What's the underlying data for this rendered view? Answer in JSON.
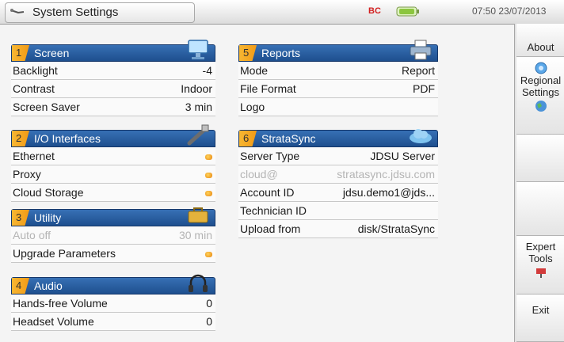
{
  "topbar": {
    "title": "System Settings",
    "bc_label": "BC",
    "datetime": "07:50 23/07/2013",
    "icons": [
      "tool-icon",
      "bc-icon",
      "battery-icon"
    ]
  },
  "panels": {
    "screen": {
      "num": "1",
      "title": "Screen",
      "icon": "monitor-icon",
      "rows": [
        {
          "label": "Backlight",
          "value": "-4"
        },
        {
          "label": "Contrast",
          "value": "Indoor"
        },
        {
          "label": "Screen Saver",
          "value": "3 min"
        }
      ]
    },
    "io": {
      "num": "2",
      "title": "I/O Interfaces",
      "icon": "cable-icon",
      "rows": [
        {
          "label": "Ethernet"
        },
        {
          "label": "Proxy"
        },
        {
          "label": "Cloud Storage"
        }
      ]
    },
    "utility": {
      "num": "3",
      "title": "Utility",
      "icon": "toolbox-icon",
      "rows": [
        {
          "label": "Auto off",
          "value": "30 min"
        },
        {
          "label": "Upgrade Parameters"
        }
      ]
    },
    "audio": {
      "num": "4",
      "title": "Audio",
      "icon": "headphones-icon",
      "rows": [
        {
          "label": "Hands-free Volume",
          "value": "0"
        },
        {
          "label": "Headset Volume",
          "value": "0"
        }
      ]
    },
    "reports": {
      "num": "5",
      "title": "Reports",
      "icon": "printer-icon",
      "rows": [
        {
          "label": "Mode",
          "value": "Report"
        },
        {
          "label": "File Format",
          "value": "PDF"
        },
        {
          "label": "Logo"
        }
      ]
    },
    "stratasync": {
      "num": "6",
      "title": "StrataSync",
      "icon": "cloud-icon",
      "rows": [
        {
          "label": "Server Type",
          "value": "JDSU Server"
        },
        {
          "label": "cloud@",
          "value": "stratasync.jdsu.com"
        },
        {
          "label": "Account ID",
          "value": "jdsu.demo1@jds..."
        },
        {
          "label": "Technician ID"
        },
        {
          "label": "Upload from",
          "value": "disk/StrataSync"
        }
      ]
    }
  },
  "sidebar": {
    "about": "About",
    "regional": "Regional Settings",
    "expert": "Expert Tools",
    "exit": "Exit"
  },
  "colors": {
    "header_blue": "#2a5fa3",
    "number_tab": "#f4a623",
    "toggle_dot": "#f0951c"
  }
}
